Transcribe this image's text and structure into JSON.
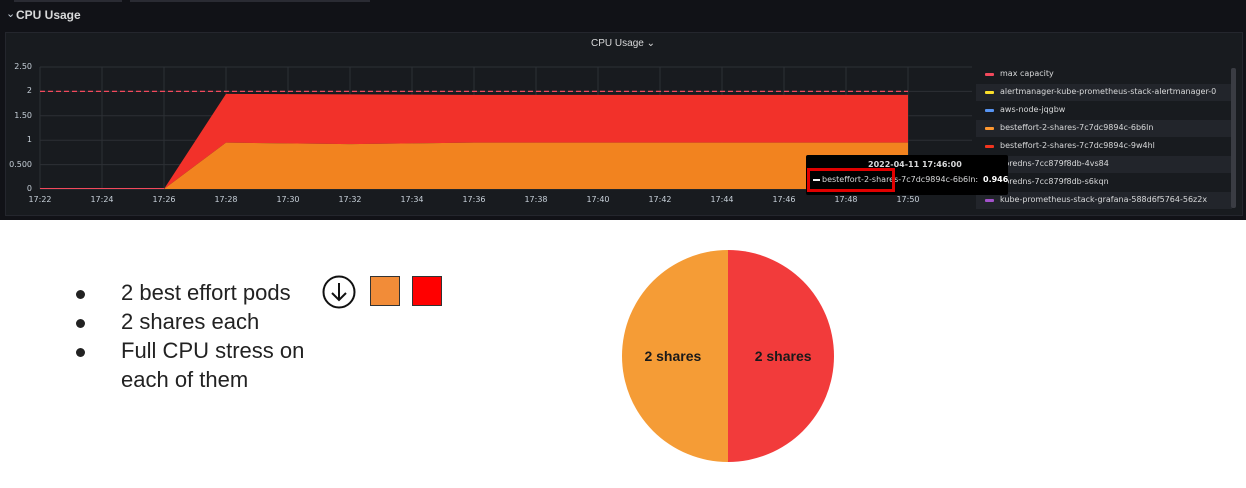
{
  "dashboard": {
    "row_title": "CPU Usage",
    "panel_title": "CPU Usage ⌄",
    "y_ticks": [
      "2.50",
      "2",
      "1.50",
      "1",
      "0.500",
      "0"
    ],
    "x_ticks": [
      "17:22",
      "17:24",
      "17:26",
      "17:28",
      "17:30",
      "17:32",
      "17:34",
      "17:36",
      "17:38",
      "17:40",
      "17:42",
      "17:44",
      "17:46",
      "17:48",
      "17:50"
    ],
    "legend": [
      {
        "label": "max capacity",
        "color": "#f2495c"
      },
      {
        "label": "alertmanager-kube-prometheus-stack-alertmanager-0",
        "color": "#fade2a"
      },
      {
        "label": "aws-node-jqgbw",
        "color": "#5794f2"
      },
      {
        "label": "besteffort-2-shares-7c7dc9894c-6b6ln",
        "color": "#ff9830"
      },
      {
        "label": "besteffort-2-shares-7c7dc9894c-9w4hl",
        "color": "#f2341e"
      },
      {
        "label": "coredns-7cc879f8db-4vs84",
        "color": "#73bf69"
      },
      {
        "label": "coredns-7cc879f8db-s6kqn",
        "color": "#8ab8ff"
      },
      {
        "label": "kube-prometheus-stack-grafana-588d6f5764-56z2x",
        "color": "#a352cc"
      }
    ],
    "tooltip": {
      "time": "2022-04-11 17:46:00",
      "series": "besteffort-2-shares-7c7dc9894c-6b6ln:",
      "value": "0.946"
    },
    "colors": {
      "orange_area": "#f2831f",
      "red_area": "#f2312a",
      "max_line": "#f2495c"
    }
  },
  "chart_data": {
    "type": "area",
    "title": "CPU Usage",
    "x": [
      "17:22",
      "17:26",
      "17:28",
      "17:32",
      "17:36",
      "17:50"
    ],
    "series": [
      {
        "name": "besteffort-2-shares-7c7dc9894c-6b6ln",
        "values": [
          0,
          0,
          0.95,
          0.92,
          0.95,
          0.95
        ]
      },
      {
        "name": "besteffort-2-shares-7c7dc9894c-9w4hl",
        "values": [
          0,
          0,
          1.0,
          1.02,
          0.98,
          0.98
        ]
      },
      {
        "name": "max capacity",
        "values": [
          2,
          2,
          2,
          2,
          2,
          2
        ]
      }
    ],
    "ylim": [
      0,
      2.5
    ],
    "stacked": true,
    "legend_position": "right"
  },
  "slide": {
    "bullets": [
      "2 best effort pods",
      "2 shares each",
      "Full CPU stress on",
      "each of them"
    ],
    "swatches": [
      "#f28c38",
      "#ff0000"
    ],
    "pie": {
      "slices": [
        {
          "label": "2 shares",
          "value": 50,
          "color": "#f59c36"
        },
        {
          "label": "2 shares",
          "value": 50,
          "color": "#f23b3b"
        }
      ]
    }
  }
}
